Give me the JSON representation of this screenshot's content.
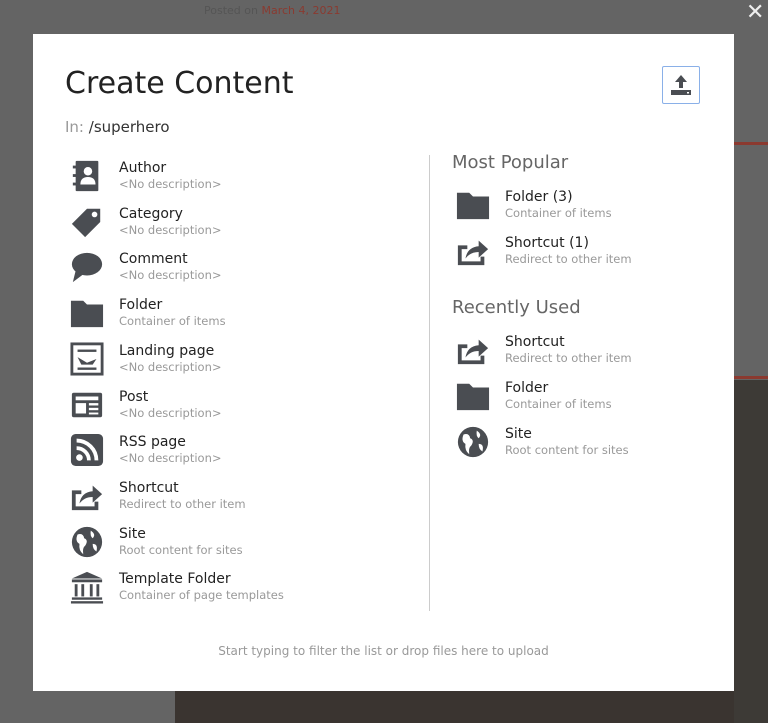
{
  "background": {
    "posted_label": "Posted on",
    "posted_date": "March 4, 2021"
  },
  "modal": {
    "title": "Create Content",
    "in_label": "In:",
    "path": "/superhero",
    "all_items": [
      {
        "name": "Author",
        "desc": "<No description>",
        "icon": "address-book-icon"
      },
      {
        "name": "Category",
        "desc": "<No description>",
        "icon": "tag-icon"
      },
      {
        "name": "Comment",
        "desc": "<No description>",
        "icon": "comment-icon"
      },
      {
        "name": "Folder",
        "desc": "Container of items",
        "icon": "folder-icon"
      },
      {
        "name": "Landing page",
        "desc": "<No description>",
        "icon": "landing-page-icon"
      },
      {
        "name": "Post",
        "desc": "<No description>",
        "icon": "newspaper-icon"
      },
      {
        "name": "RSS page",
        "desc": "<No description>",
        "icon": "rss-icon"
      },
      {
        "name": "Shortcut",
        "desc": "Redirect to other item",
        "icon": "share-icon"
      },
      {
        "name": "Site",
        "desc": "Root content for sites",
        "icon": "globe-icon"
      },
      {
        "name": "Template Folder",
        "desc": "Container of page templates",
        "icon": "institution-icon"
      }
    ],
    "most_popular_heading": "Most Popular",
    "most_popular": [
      {
        "name": "Folder (3)",
        "desc": "Container of items",
        "icon": "folder-icon"
      },
      {
        "name": "Shortcut (1)",
        "desc": "Redirect to other item",
        "icon": "share-icon"
      }
    ],
    "recent_heading": "Recently Used",
    "recent": [
      {
        "name": "Shortcut",
        "desc": "Redirect to other item",
        "icon": "share-icon"
      },
      {
        "name": "Folder",
        "desc": "Container of items",
        "icon": "folder-icon"
      },
      {
        "name": "Site",
        "desc": "Root content for sites",
        "icon": "globe-icon"
      }
    ],
    "footer": "Start typing to filter the list or drop files here to upload"
  },
  "colors": {
    "icon": "#4a4d52",
    "upload_border": "#8ab0e8"
  }
}
